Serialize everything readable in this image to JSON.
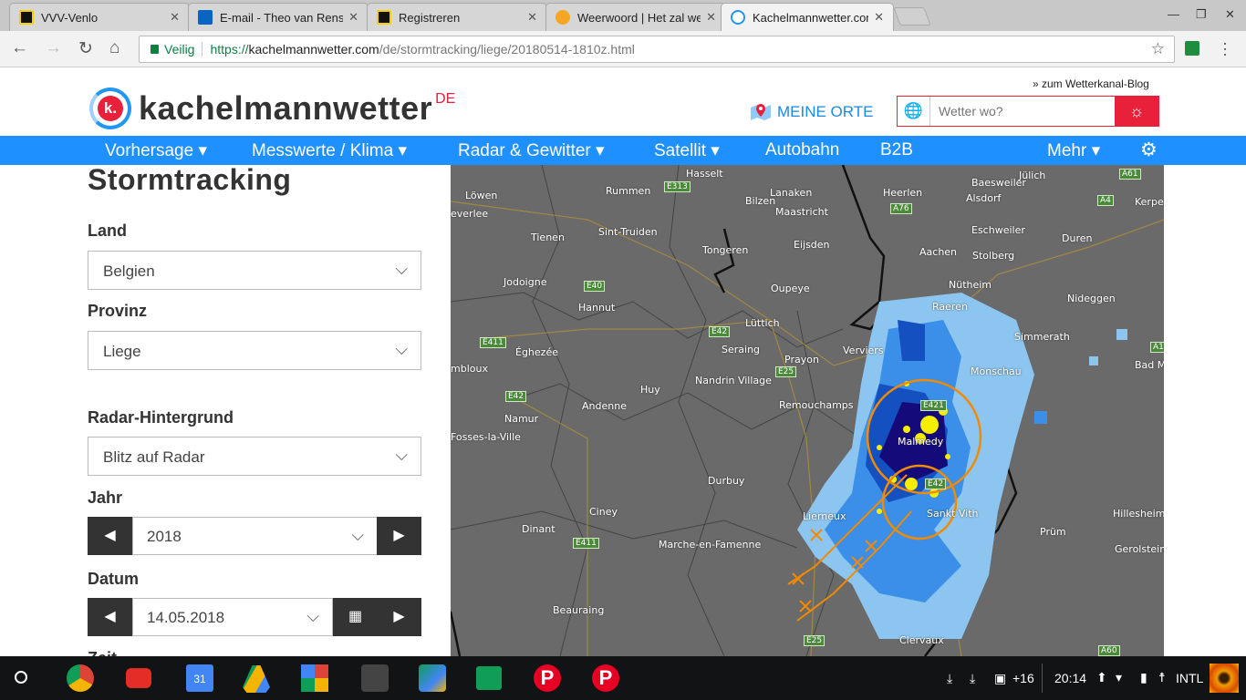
{
  "browser": {
    "tabs": [
      {
        "title": "VVV-Venlo"
      },
      {
        "title": "E-mail - Theo van Rensen"
      },
      {
        "title": "Registreren"
      },
      {
        "title": "Weerwoord | Het zal weer"
      },
      {
        "title": "Kachelmannwetter.com",
        "active": true
      }
    ],
    "secure_label": "Veilig",
    "url_scheme": "https://",
    "url_domain": "kachelmannwetter.com",
    "url_path": "/de/stormtracking/liege/20180514-1810z.html"
  },
  "header": {
    "logo_text": "kachelmannwetter",
    "logo_suffix": "DE",
    "logo_mark": "k.",
    "blog_link": "» zum Wetterkanal-Blog",
    "meine_orte": "MEINE ORTE",
    "search_placeholder": "Wetter wo?"
  },
  "nav": {
    "items": [
      "Vorhersage ▾",
      "Messwerte / Klima ▾",
      "Radar & Gewitter ▾",
      "Satellit ▾",
      "Autobahn",
      "B2B",
      "Mehr ▾"
    ]
  },
  "panel": {
    "title": "Stormtracking",
    "land_label": "Land",
    "land_value": "Belgien",
    "provinz_label": "Provinz",
    "provinz_value": "Liege",
    "bg_label": "Radar-Hintergrund",
    "bg_value": "Blitz auf Radar",
    "jahr_label": "Jahr",
    "jahr_value": "2018",
    "datum_label": "Datum",
    "datum_value": "14.05.2018",
    "zeit_label": "Zeit"
  },
  "map": {
    "places": [
      "Hasselt",
      "Löwen",
      "Rummen",
      "Bilzen",
      "Lanaken",
      "Heerlen",
      "Baesweiler",
      "Jülich",
      "Alsdorf",
      "Kerpe",
      "Maastricht",
      "everlee",
      "Tienen",
      "Sint-Truiden",
      "Tongeren",
      "Eijsden",
      "Eschweiler",
      "Duren",
      "Aachen",
      "Stolberg",
      "Jodoigne",
      "Oupeye",
      "Nütheim",
      "Nideggen",
      "Hannut",
      "Raeren",
      "Lüttich",
      "Verviers",
      "Simmerath",
      "Éghezée",
      "Seraing",
      "Prayon",
      "Monschau",
      "Bad M",
      "mbloux",
      "Nandrin Village",
      "Huy",
      "Andenne",
      "Remouchamps",
      "Namur",
      "Malmedy",
      "Fosses-la-Ville",
      "Durbuy",
      "Ciney",
      "Lierneux",
      "Sankt Vith",
      "Hillesheim",
      "Dinant",
      "Marche-en-Famenne",
      "Prüm",
      "Gerolstein",
      "Beauraing",
      "Clervaux"
    ],
    "roads": [
      "E313",
      "A61",
      "A4",
      "A76",
      "E40",
      "E42",
      "E411",
      "A1",
      "E25",
      "E42",
      "E421",
      "E42",
      "E411",
      "E25",
      "A60"
    ]
  },
  "shelf": {
    "notif_count": "+16",
    "time": "20:14",
    "ime": "INTL"
  },
  "colors": {
    "accent": "#1e90ff",
    "brand_red": "#e8203a"
  }
}
